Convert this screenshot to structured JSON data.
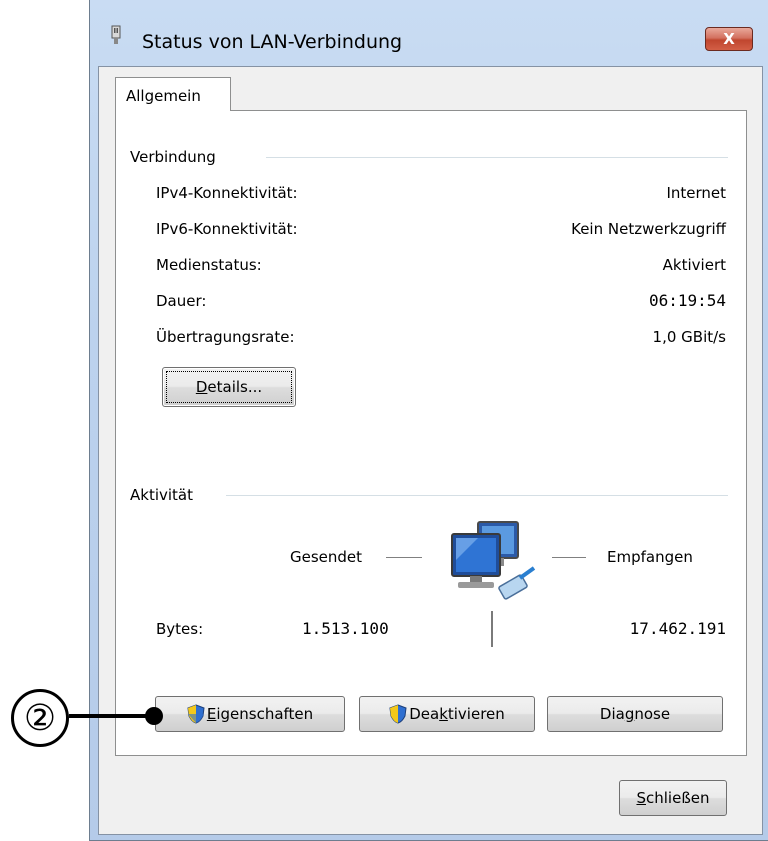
{
  "window": {
    "title": "Status von LAN-Verbindung",
    "close_label": "X"
  },
  "tab": {
    "label": "Allgemein"
  },
  "connection": {
    "header": "Verbindung",
    "rows": [
      {
        "label": "IPv4-Konnektivität:",
        "value": "Internet"
      },
      {
        "label": "IPv6-Konnektivität:",
        "value": "Kein Netzwerkzugriff"
      },
      {
        "label": "Medienstatus:",
        "value": "Aktiviert"
      },
      {
        "label": "Dauer:",
        "value": "06:19:54"
      },
      {
        "label": "Übertragungsrate:",
        "value": "1,0 GBit/s"
      }
    ],
    "details_prefix": "",
    "details_accel": "D",
    "details_rest": "etails..."
  },
  "activity": {
    "header": "Aktivität",
    "sent_label": "Gesendet",
    "received_label": "Empfangen",
    "bytes_label": "Bytes:",
    "bytes_sent": "1.513.100",
    "bytes_received": "17.462.191"
  },
  "buttons": {
    "properties": {
      "accel": "E",
      "rest": "igenschaften"
    },
    "disable": {
      "pre": "Dea",
      "accel": "k",
      "rest": "tivieren"
    },
    "diagnose": {
      "pre": "Dia",
      "accel": "g",
      "rest": "nose"
    },
    "close": {
      "accel": "S",
      "rest": "chließen"
    }
  },
  "callout": {
    "number": "②"
  },
  "colors": {
    "accent": "#1f5fbf",
    "close_button": "#c8503a"
  }
}
